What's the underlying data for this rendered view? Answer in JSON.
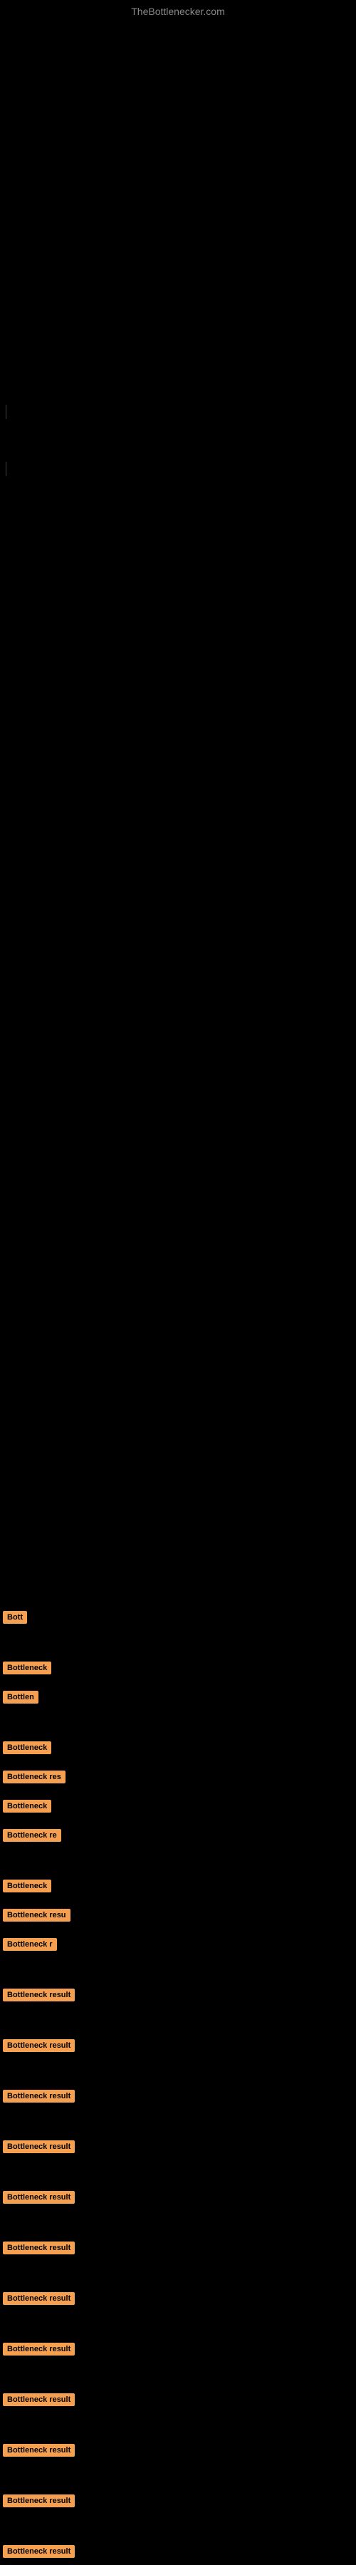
{
  "site": {
    "title": "TheBottlenecker.com"
  },
  "results": [
    {
      "id": 1,
      "label": "Bott",
      "short": true
    },
    {
      "id": 2,
      "label": "Bottleneck",
      "short": false
    },
    {
      "id": 3,
      "label": "Bottlen",
      "short": true
    },
    {
      "id": 4,
      "label": "Bottleneck",
      "short": false
    },
    {
      "id": 5,
      "label": "Bottleneck res",
      "short": false
    },
    {
      "id": 6,
      "label": "Bottleneck",
      "short": false
    },
    {
      "id": 7,
      "label": "Bottleneck re",
      "short": false
    },
    {
      "id": 8,
      "label": "Bottleneck",
      "short": false
    },
    {
      "id": 9,
      "label": "Bottleneck resu",
      "short": false
    },
    {
      "id": 10,
      "label": "Bottleneck r",
      "short": false
    },
    {
      "id": 11,
      "label": "Bottleneck result",
      "short": false
    },
    {
      "id": 12,
      "label": "Bottleneck result",
      "short": false
    },
    {
      "id": 13,
      "label": "Bottleneck result",
      "short": false
    },
    {
      "id": 14,
      "label": "Bottleneck result",
      "short": false
    },
    {
      "id": 15,
      "label": "Bottleneck result",
      "short": false
    },
    {
      "id": 16,
      "label": "Bottleneck result",
      "short": false
    },
    {
      "id": 17,
      "label": "Bottleneck result",
      "short": false
    },
    {
      "id": 18,
      "label": "Bottleneck result",
      "short": false
    },
    {
      "id": 19,
      "label": "Bottleneck result",
      "short": false
    },
    {
      "id": 20,
      "label": "Bottleneck result",
      "short": false
    },
    {
      "id": 21,
      "label": "Bottleneck result",
      "short": false
    },
    {
      "id": 22,
      "label": "Bottleneck result",
      "short": false
    }
  ]
}
